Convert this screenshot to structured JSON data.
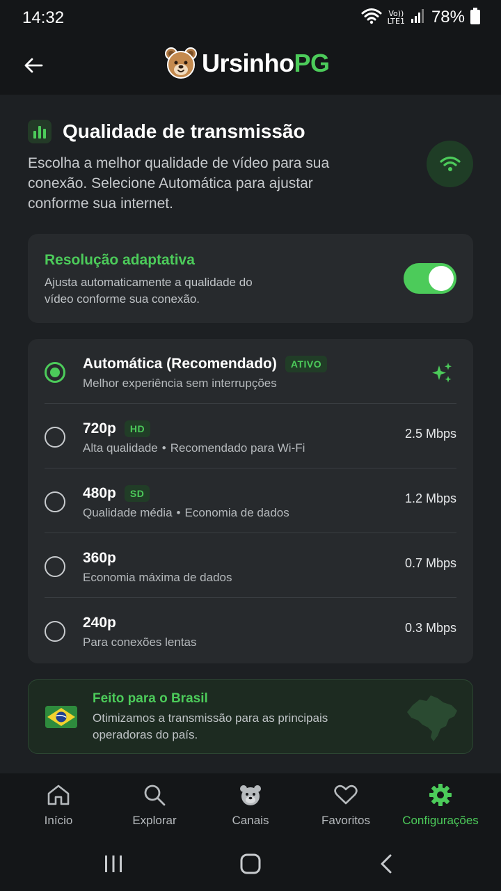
{
  "status": {
    "time": "14:32",
    "network": "Vo))\nLTE1",
    "battery": "78%"
  },
  "app": {
    "name_part1": "Ursinho",
    "name_part2": "PG"
  },
  "section": {
    "title": "Qualidade de transmissão",
    "description": "Escolha a melhor qualidade de vídeo para sua conexão. Selecione Automática para ajustar conforme sua internet."
  },
  "adaptive": {
    "title": "Resolução adaptativa",
    "description": "Ajusta automaticamente a qualidade do vídeo conforme sua conexão.",
    "enabled": true
  },
  "options": [
    {
      "name": "Automática (Recomendado)",
      "badge": "ATIVO",
      "sub1": "Melhor experiência sem interrupções",
      "sub2": "",
      "rate": "",
      "selected": true
    },
    {
      "name": "720p",
      "badge": "HD",
      "sub1": "Alta qualidade",
      "sub2": "Recomendado para Wi-Fi",
      "rate": "2.5 Mbps",
      "selected": false
    },
    {
      "name": "480p",
      "badge": "SD",
      "sub1": "Qualidade média",
      "sub2": "Economia de dados",
      "rate": "1.2 Mbps",
      "selected": false
    },
    {
      "name": "360p",
      "badge": "",
      "sub1": "Economia máxima de dados",
      "sub2": "",
      "rate": "0.7 Mbps",
      "selected": false
    },
    {
      "name": "240p",
      "badge": "",
      "sub1": "Para conexões lentas",
      "sub2": "",
      "rate": "0.3 Mbps",
      "selected": false
    }
  ],
  "brasil": {
    "title": "Feito para o Brasil",
    "description": "Otimizamos a transmissão para as principais operadoras do país."
  },
  "nav": [
    {
      "label": "Início",
      "icon": "home-icon",
      "active": false
    },
    {
      "label": "Explorar",
      "icon": "search-icon",
      "active": false
    },
    {
      "label": "Canais",
      "icon": "bear-icon",
      "active": false
    },
    {
      "label": "Favoritos",
      "icon": "heart-icon",
      "active": false
    },
    {
      "label": "Configurações",
      "icon": "gear-icon",
      "active": true
    }
  ],
  "colors": {
    "accent": "#4ccb5a",
    "background": "#1d2023",
    "card": "#272a2d"
  }
}
